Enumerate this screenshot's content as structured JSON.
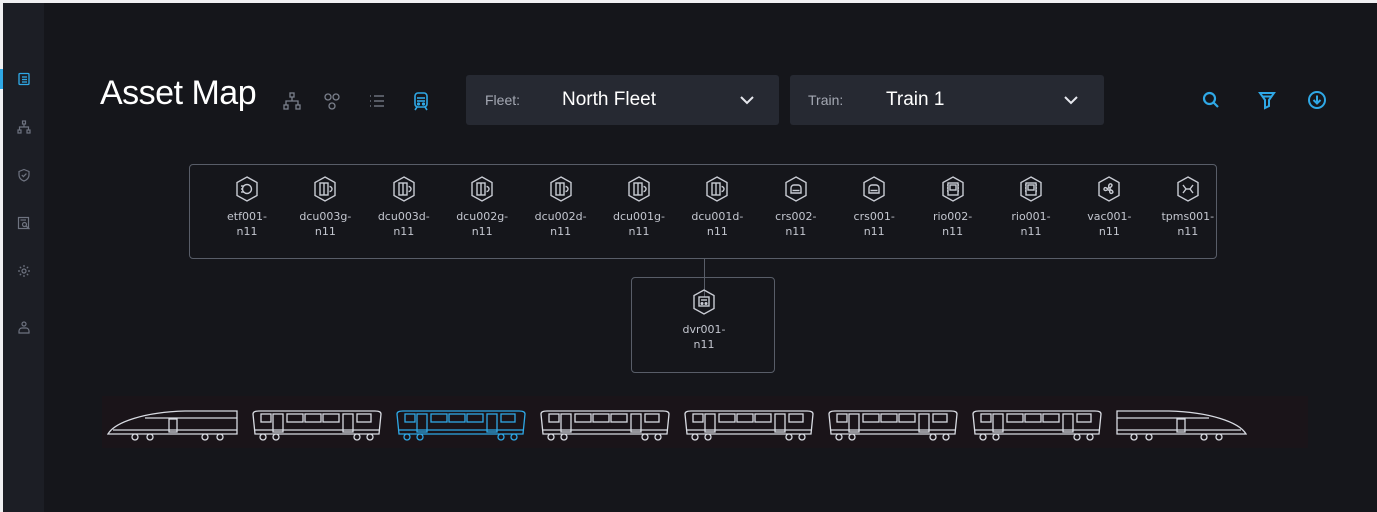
{
  "sidebar": {
    "items": [
      {
        "icon": "list-icon",
        "active": true
      },
      {
        "icon": "hierarchy-icon",
        "active": false
      },
      {
        "icon": "shield-check-icon",
        "active": false
      },
      {
        "icon": "report-search-icon",
        "active": false
      },
      {
        "icon": "settings-icon",
        "active": false
      },
      {
        "icon": "user-icon",
        "active": false
      }
    ]
  },
  "header": {
    "title": "Asset Map",
    "views": [
      {
        "icon": "hierarchy-icon",
        "active": false
      },
      {
        "icon": "node-graph-icon",
        "active": false
      },
      {
        "icon": "list-view-icon",
        "active": false
      },
      {
        "icon": "train-icon",
        "active": true
      }
    ],
    "fleet_select": {
      "label": "Fleet:",
      "value": "North Fleet"
    },
    "train_select": {
      "label": "Train:",
      "value": "Train 1"
    },
    "actions": [
      "search-icon",
      "filter-icon",
      "download-icon"
    ],
    "accent_color": "#2fa8e6"
  },
  "assets": [
    {
      "name": "etf001-\nn11",
      "icon": "etf-icon"
    },
    {
      "name": "dcu003g-\nn11",
      "icon": "door-icon"
    },
    {
      "name": "dcu003d-\nn11",
      "icon": "door-icon"
    },
    {
      "name": "dcu002g-\nn11",
      "icon": "door-icon"
    },
    {
      "name": "dcu002d-\nn11",
      "icon": "door-icon"
    },
    {
      "name": "dcu001g-\nn11",
      "icon": "door-icon"
    },
    {
      "name": "dcu001d-\nn11",
      "icon": "door-icon"
    },
    {
      "name": "crs002-\nn11",
      "icon": "seat-icon"
    },
    {
      "name": "crs001-\nn11",
      "icon": "seat-icon"
    },
    {
      "name": "rio002-\nn11",
      "icon": "chip-icon"
    },
    {
      "name": "rio001-\nn11",
      "icon": "chip-icon"
    },
    {
      "name": "vac001-\nn11",
      "icon": "fan-icon"
    },
    {
      "name": "tpms001-\nn11",
      "icon": "tpms-icon"
    }
  ],
  "child_asset": {
    "name": "dvr001-\nn11",
    "icon": "dvr-icon"
  },
  "train": {
    "cars": [
      {
        "type": "head-left",
        "selected": false
      },
      {
        "type": "middle",
        "selected": false
      },
      {
        "type": "middle",
        "selected": true
      },
      {
        "type": "middle",
        "selected": false
      },
      {
        "type": "middle",
        "selected": false
      },
      {
        "type": "middle",
        "selected": false
      },
      {
        "type": "middle",
        "selected": false
      },
      {
        "type": "head-right",
        "selected": false
      }
    ],
    "selected_color": "#2fa8e6",
    "car_color": "#d8dbe2"
  }
}
